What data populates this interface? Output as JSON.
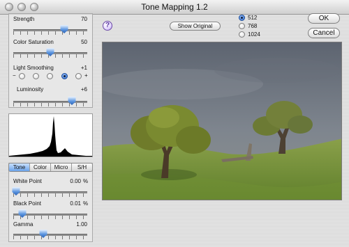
{
  "window": {
    "title": "Tone Mapping 1.2"
  },
  "sliders_top": {
    "strength": {
      "label": "Strength",
      "value": "70",
      "level": 0.7
    },
    "color_saturation": {
      "label": "Color Saturation",
      "value": "50",
      "level": 0.5
    },
    "light_smoothing": {
      "label": "Light Smoothing",
      "value": "+1",
      "minus": "−",
      "plus": "+",
      "options": [
        "-2",
        "-1",
        "0",
        "+1",
        "+2"
      ],
      "selected": "+1"
    },
    "luminosity": {
      "label": "Luminosity",
      "value": "+6",
      "level": 0.78
    }
  },
  "tabs": {
    "items": [
      "Tone",
      "Color",
      "Micro",
      "S/H"
    ],
    "active": "Tone"
  },
  "sliders_bottom": {
    "white_point": {
      "label": "White Point",
      "value": "0.00",
      "unit": "%",
      "level": 0.05
    },
    "black_point": {
      "label": "Black Point",
      "value": "0.01",
      "unit": "%",
      "level": 0.12
    },
    "gamma": {
      "label": "Gamma",
      "value": "1.00",
      "level": 0.45
    }
  },
  "toolbar": {
    "help_label": "?",
    "show_original_label": "Show Original"
  },
  "preview_size": {
    "options": [
      "512",
      "768",
      "1024"
    ],
    "selected": "512"
  },
  "buttons": {
    "ok_label": "OK",
    "cancel_label": "Cancel"
  },
  "colors": {
    "accent": "#3b78d6",
    "help": "#6c4aa5"
  }
}
